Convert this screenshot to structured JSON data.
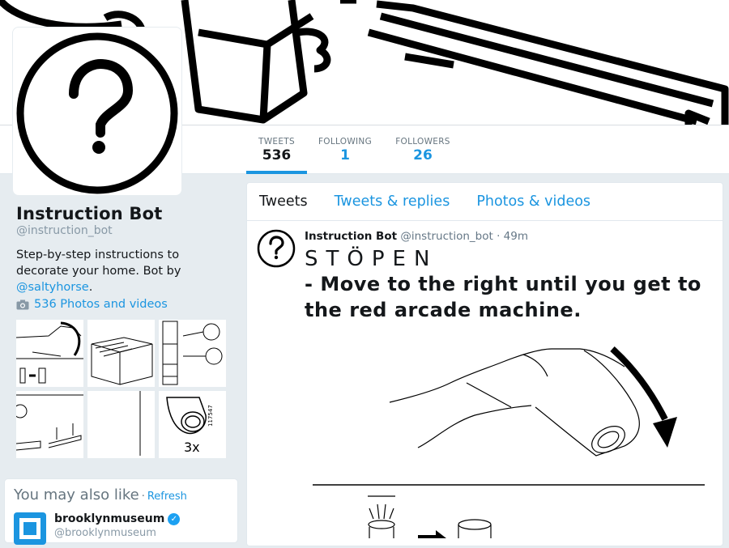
{
  "profile": {
    "name": "Instruction Bot",
    "handle": "@instruction_bot",
    "bio_prefix": "Step-by-step instructions to decorate your home. Bot by ",
    "bio_mention": "@saltyhorse",
    "bio_suffix": "."
  },
  "stats": [
    {
      "label": "TWEETS",
      "value": "536"
    },
    {
      "label": "FOLLOWING",
      "value": "1"
    },
    {
      "label": "FOLLOWERS",
      "value": "26"
    }
  ],
  "photos_link": "536 Photos and videos",
  "tabs": [
    {
      "label": "Tweets"
    },
    {
      "label": "Tweets & replies"
    },
    {
      "label": "Photos & videos"
    }
  ],
  "tweet": {
    "name": "Instruction Bot",
    "handle": "@instruction_bot",
    "separator": "·",
    "time": "49m",
    "title": "STÖPEN",
    "text": "- Move to the right until you get to the red arcade machine."
  },
  "suggestions": {
    "title": "You may also like",
    "separator": "·",
    "refresh": "Refresh",
    "account": {
      "name": "brooklynmuseum",
      "handle": "@brooklynmuseum"
    }
  },
  "thumb_labels": {
    "t6_count": "3x",
    "t6_code": "117547"
  },
  "colors": {
    "accent": "#1b95e0",
    "background": "#e6ecf0"
  },
  "icons": [
    "camera-icon",
    "question-mark-icon",
    "verified-icon"
  ]
}
